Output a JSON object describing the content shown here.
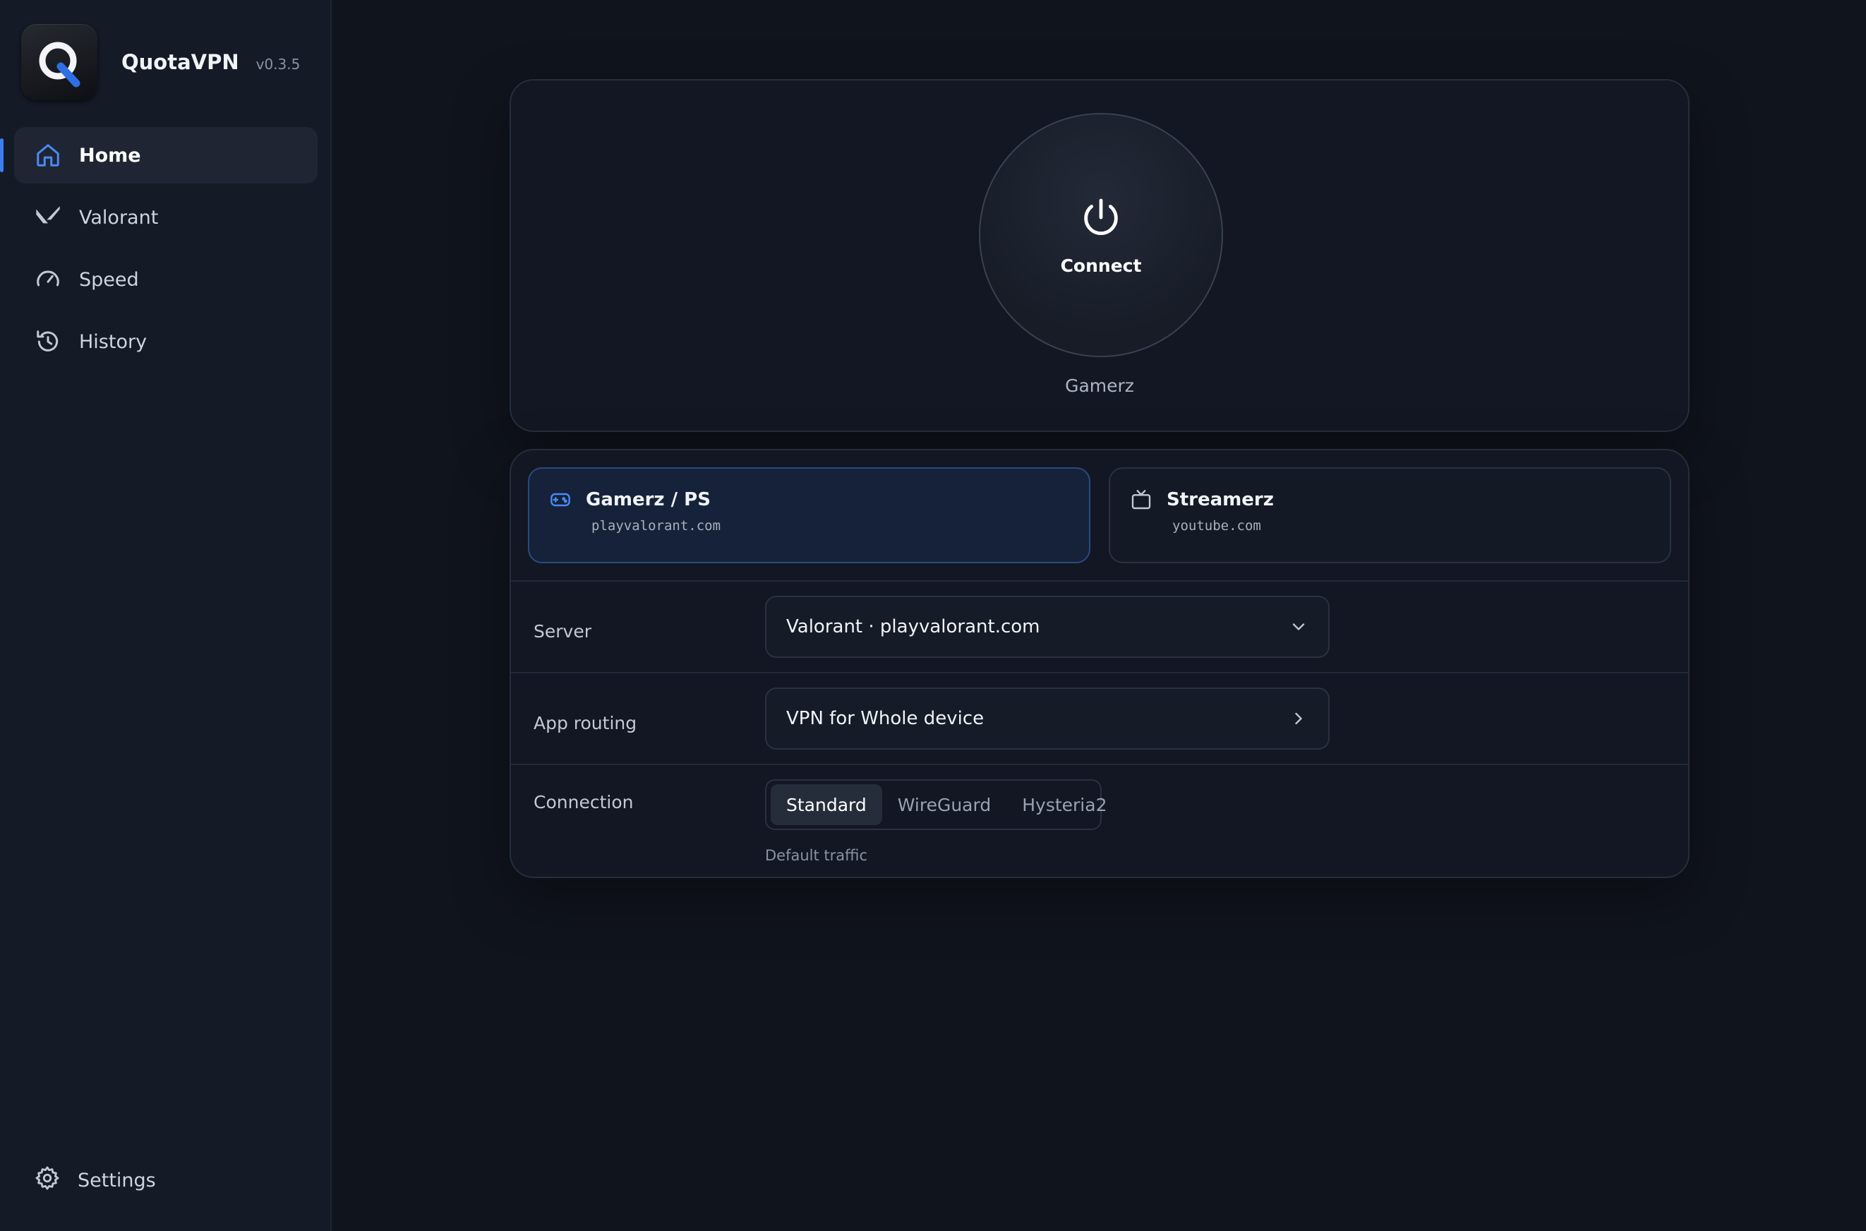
{
  "app": {
    "name": "QuotaVPN",
    "version": "v0.3.5"
  },
  "sidebar": {
    "items": [
      {
        "label": "Home",
        "icon": "home-icon",
        "active": true
      },
      {
        "label": "Valorant",
        "icon": "valorant-icon",
        "active": false
      },
      {
        "label": "Speed",
        "icon": "speedometer-icon",
        "active": false
      },
      {
        "label": "History",
        "icon": "history-icon",
        "active": false
      }
    ],
    "settings": {
      "label": "Settings",
      "icon": "gear-icon"
    }
  },
  "connect": {
    "button_label": "Connect",
    "icon": "power-icon",
    "profile_caption": "Gamerz"
  },
  "profiles": [
    {
      "name": "Gamerz / PS",
      "domain": "playvalorant.com",
      "icon": "gamepad-icon",
      "selected": true
    },
    {
      "name": "Streamerz",
      "domain": "youtube.com",
      "icon": "tv-icon",
      "selected": false
    }
  ],
  "settings_rows": {
    "server": {
      "label": "Server",
      "value": "Valorant · playvalorant.com"
    },
    "routing": {
      "label": "App routing",
      "value": "VPN for Whole device"
    },
    "connection": {
      "label": "Connection",
      "options": [
        "Standard",
        "WireGuard",
        "Hysteria2"
      ],
      "selected": "Standard",
      "hint": "Default traffic"
    }
  },
  "colors": {
    "background": "#10141d",
    "sidebar": "#141a26",
    "accent": "#3d7ef2",
    "selected_profile": "#15223a"
  }
}
